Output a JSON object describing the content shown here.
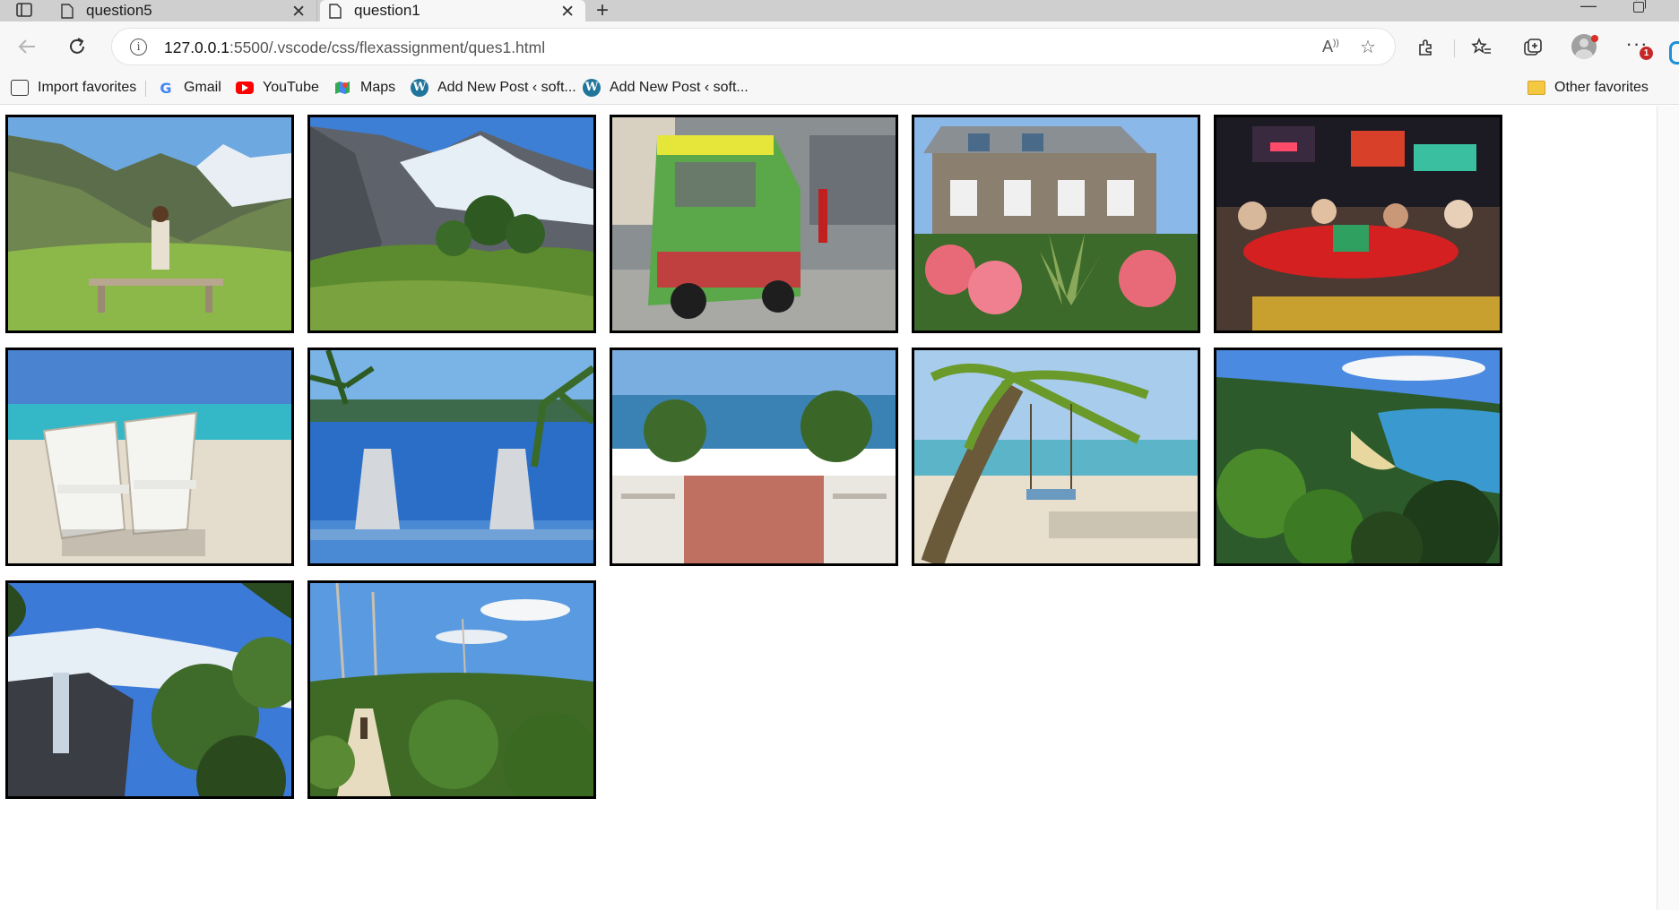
{
  "browser": {
    "tabs": [
      {
        "title": "question5",
        "active": false
      },
      {
        "title": "question1",
        "active": true
      }
    ],
    "address": {
      "host": "127.0.0.1",
      "path": ":5500/.vscode/css/flexassignment/ques1.html"
    },
    "more_badge": "1",
    "bookmarks": [
      {
        "label": "Import favorites",
        "icon": "import-icon"
      },
      {
        "label": "Gmail",
        "icon": "google-icon"
      },
      {
        "label": "YouTube",
        "icon": "youtube-icon"
      },
      {
        "label": "Maps",
        "icon": "maps-icon"
      },
      {
        "label": "Add New Post ‹ soft...",
        "icon": "wordpress-icon"
      },
      {
        "label": "Add New Post ‹ soft...",
        "icon": "wordpress-icon"
      }
    ],
    "other_favorites": "Other favorites"
  },
  "gallery": {
    "images": [
      {
        "scene": "mountain-valley-woman-bench"
      },
      {
        "scene": "glacier-mountain-forest"
      },
      {
        "scene": "food-truck-street"
      },
      {
        "scene": "stone-house-flowers"
      },
      {
        "scene": "night-street-restaurant"
      },
      {
        "scene": "beach-lounge-chairs"
      },
      {
        "scene": "infinity-pool-palms"
      },
      {
        "scene": "resort-stairs-sea"
      },
      {
        "scene": "palm-tree-beach-swing"
      },
      {
        "scene": "bay-beach-ferns"
      },
      {
        "scene": "waterfall-glacier-trees"
      },
      {
        "scene": "forest-path-hiker"
      }
    ]
  },
  "colors": {
    "tabstrip": "#cfcfcf",
    "toolbar": "#f7f7f7",
    "photo_border": "#000000"
  }
}
